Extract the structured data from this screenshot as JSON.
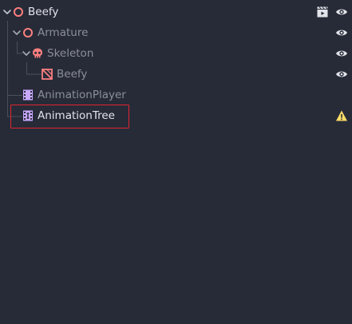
{
  "scene_tree": {
    "nodes": [
      {
        "label": "Beefy",
        "icon": "spatial-node-icon",
        "expanded": true,
        "actions": [
          "scene-instance-icon",
          "visibility-eye-icon"
        ]
      },
      {
        "label": "Armature",
        "icon": "spatial-node-icon",
        "expanded": true,
        "actions": [
          "visibility-eye-icon"
        ]
      },
      {
        "label": "Skeleton",
        "icon": "skeleton-skull-icon",
        "expanded": true,
        "actions": [
          "visibility-eye-icon"
        ]
      },
      {
        "label": "Beefy",
        "icon": "mesh-instance-icon",
        "expanded": false,
        "actions": [
          "visibility-eye-icon"
        ]
      },
      {
        "label": "AnimationPlayer",
        "icon": "animation-player-icon",
        "expanded": false,
        "actions": []
      },
      {
        "label": "AnimationTree",
        "icon": "animation-tree-icon",
        "expanded": false,
        "actions": [
          "warning-icon"
        ],
        "highlighted": true
      }
    ]
  },
  "colors": {
    "background": "#272b38",
    "text_primary": "#e2e4ea",
    "text_dim": "#8c8f99",
    "spatial_node": "#fc7f7f",
    "animation_node": "#c8a8ff",
    "warning": "#ffdd66",
    "highlight_border": "#e0262e"
  }
}
